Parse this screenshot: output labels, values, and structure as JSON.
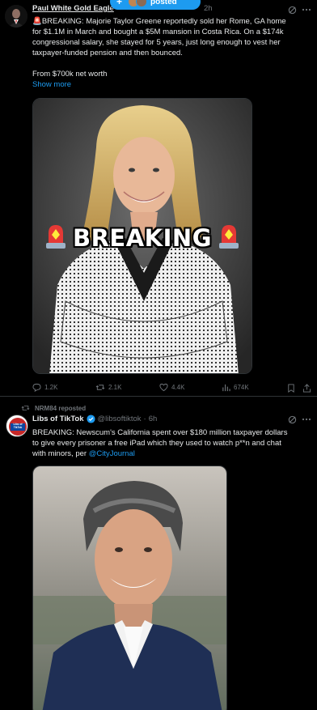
{
  "colors": {
    "accent": "#1d9bf0",
    "muted": "#71767b",
    "text": "#e7e9ea",
    "background": "#000000"
  },
  "posted_pill": {
    "plus": "+",
    "label": "posted"
  },
  "tweet1": {
    "author_name": "Paul White Gold Eagle",
    "time": "2h",
    "text_line1": "🚨BREAKING: Majorie Taylor Greene reportedly sold her Rome, GA home",
    "text_line2": "for $1.1M in March and bought a $5M mansion in Costa Rica. On a $174k",
    "text_line3": "congressional salary, she stayed for 5 years, just long enough to vest her",
    "text_line4": "taxpayer-funded pension and then bounced.",
    "text_line5": "From $700k net worth",
    "show_more": "Show more",
    "image_overlay": "BREAKING",
    "replies": "1.2K",
    "reposts": "2.1K",
    "likes": "4.4K",
    "views": "674K"
  },
  "tweet2": {
    "repost_label": "NRM84 reposted",
    "author_name": "Libs of TikTok",
    "handle": "@libsoftiktok",
    "separator": "·",
    "time": "6h",
    "text_line1": "BREAKING: Newscum's California spent over $180 million taxpayer dollars",
    "text_line2": "to give every prisoner a free iPad which they used to watch p**n and chat",
    "text_line3_prefix": "with minors, per ",
    "mention": "@CityJournal",
    "avatar_text": "Libs of TikTok"
  }
}
